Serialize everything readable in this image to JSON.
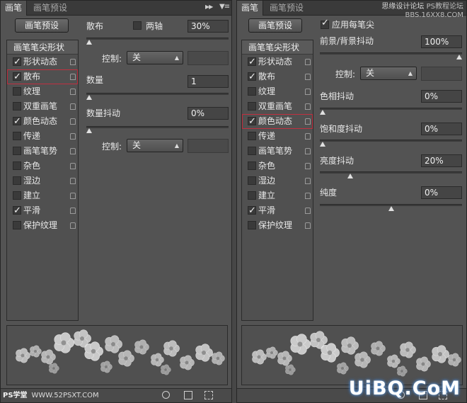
{
  "left_panel": {
    "tabs": [
      "画笔",
      "画笔预设"
    ],
    "preset_button": "画笔预设",
    "list_header": "画笔笔尖形状",
    "items": [
      {
        "label": "形状动态",
        "checked": true,
        "highlighted": false
      },
      {
        "label": "散布",
        "checked": true,
        "highlighted": true
      },
      {
        "label": "纹理",
        "checked": false,
        "highlighted": false
      },
      {
        "label": "双重画笔",
        "checked": false,
        "highlighted": false
      },
      {
        "label": "颜色动态",
        "checked": true,
        "highlighted": false
      },
      {
        "label": "传递",
        "checked": false,
        "highlighted": false
      },
      {
        "label": "画笔笔势",
        "checked": false,
        "highlighted": false
      },
      {
        "label": "杂色",
        "checked": false,
        "highlighted": false
      },
      {
        "label": "湿边",
        "checked": false,
        "highlighted": false
      },
      {
        "label": "建立",
        "checked": false,
        "highlighted": false
      },
      {
        "label": "平滑",
        "checked": true,
        "highlighted": false
      },
      {
        "label": "保护纹理",
        "checked": false,
        "highlighted": false
      }
    ],
    "scatter_label": "散布",
    "both_axes_label": "两轴",
    "both_axes_checked": false,
    "scatter_value": "30%",
    "scatter_fraction": 0.0,
    "control_label": "控制:",
    "control_value": "关",
    "count_label": "数量",
    "count_value": "1",
    "count_fraction": 0.0,
    "count_jitter_label": "数量抖动",
    "count_jitter_value": "0%",
    "count_jitter_fraction": 0.0,
    "control2_label": "控制:",
    "control2_value": "关"
  },
  "right_panel": {
    "tabs": [
      "画笔",
      "画笔预设"
    ],
    "watermark_line1": "思缘设计论坛",
    "watermark_line1b": "PS教程论坛",
    "watermark_line2": "BBS.16XX8.COM",
    "preset_button": "画笔预设",
    "apply_per_tip_label": "应用每笔尖",
    "apply_per_tip_checked": true,
    "list_header": "画笔笔尖形状",
    "items": [
      {
        "label": "形状动态",
        "checked": true,
        "highlighted": false
      },
      {
        "label": "散布",
        "checked": true,
        "highlighted": false
      },
      {
        "label": "纹理",
        "checked": false,
        "highlighted": false
      },
      {
        "label": "双重画笔",
        "checked": false,
        "highlighted": false
      },
      {
        "label": "颜色动态",
        "checked": true,
        "highlighted": true
      },
      {
        "label": "传递",
        "checked": false,
        "highlighted": false
      },
      {
        "label": "画笔笔势",
        "checked": false,
        "highlighted": false
      },
      {
        "label": "杂色",
        "checked": false,
        "highlighted": false
      },
      {
        "label": "湿边",
        "checked": false,
        "highlighted": false
      },
      {
        "label": "建立",
        "checked": false,
        "highlighted": false
      },
      {
        "label": "平滑",
        "checked": true,
        "highlighted": false
      },
      {
        "label": "保护纹理",
        "checked": false,
        "highlighted": false
      }
    ],
    "fg_bg_label": "前景/背景抖动",
    "fg_bg_value": "100%",
    "fg_bg_fraction": 1.0,
    "control_label": "控制:",
    "control_value": "关",
    "hue_label": "色相抖动",
    "hue_value": "0%",
    "hue_fraction": 0.0,
    "saturation_label": "饱和度抖动",
    "saturation_value": "0%",
    "saturation_fraction": 0.0,
    "brightness_label": "亮度抖动",
    "brightness_value": "20%",
    "brightness_fraction": 0.2,
    "purity_label": "纯度",
    "purity_value": "0%",
    "purity_fraction": 0.5
  },
  "logos": {
    "ps_logo": "PS学堂",
    "ps_logo_url": "WWW.52PSXT.COM",
    "site_logo": "UiBQ.CoM"
  }
}
